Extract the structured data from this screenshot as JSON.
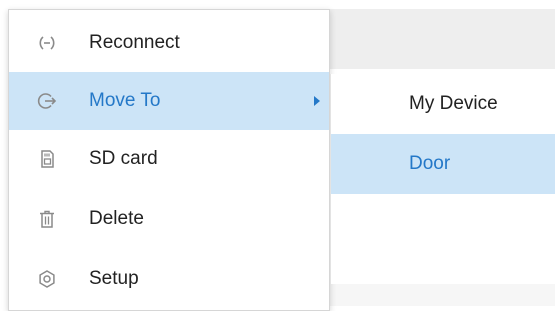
{
  "context_menu": {
    "items": [
      {
        "label": "Reconnect",
        "icon": "reconnect-icon"
      },
      {
        "label": "Move To",
        "icon": "move-to-icon",
        "has_submenu": true,
        "highlighted": true
      },
      {
        "label": "SD card",
        "icon": "sd-card-icon"
      },
      {
        "label": "Delete",
        "icon": "trash-icon"
      },
      {
        "label": "Setup",
        "icon": "settings-icon"
      }
    ]
  },
  "submenu": {
    "items": [
      {
        "label": "My Device"
      },
      {
        "label": "Door",
        "highlighted": true
      }
    ]
  },
  "colors": {
    "highlight_bg": "#cce4f7",
    "highlight_text": "#2478c8",
    "text": "#222222",
    "icon": "#8a8a8a"
  }
}
